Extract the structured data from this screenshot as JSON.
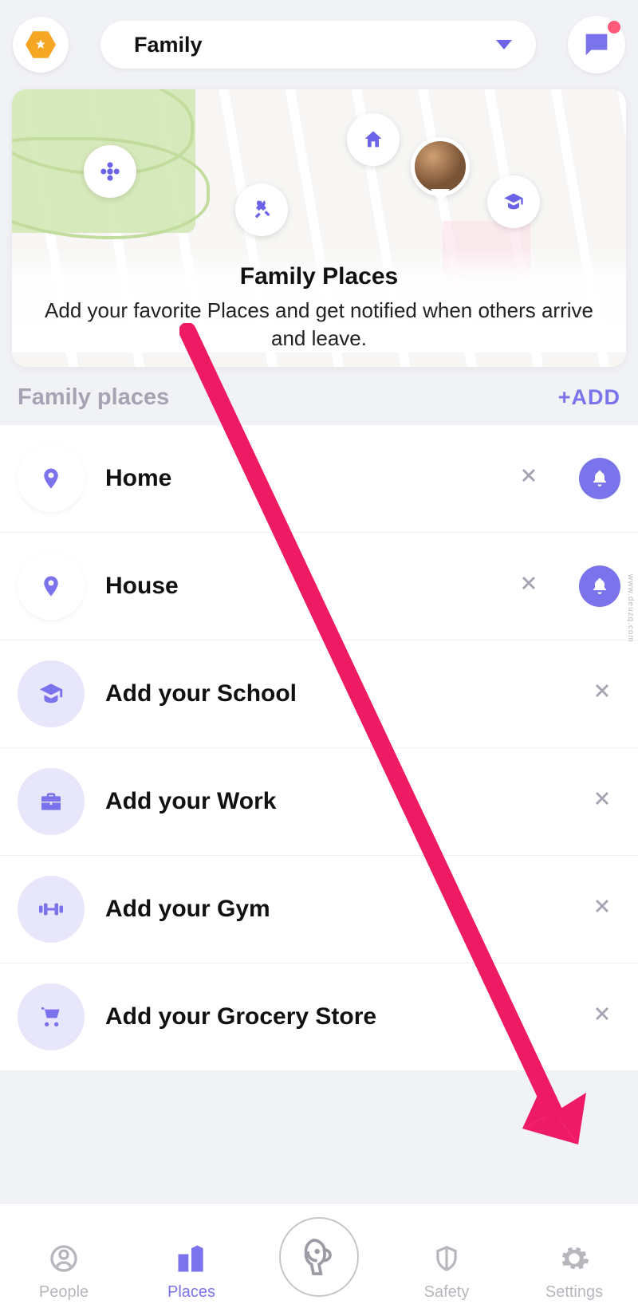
{
  "header": {
    "circle_name": "Family"
  },
  "hero": {
    "title": "Family Places",
    "subtitle": "Add your favorite Places and get notified when others arrive and leave."
  },
  "section": {
    "title": "Family places",
    "add_label": "+ADD"
  },
  "places": [
    {
      "label": "Home",
      "icon": "pin",
      "style": "solid",
      "has_bell": true
    },
    {
      "label": "House",
      "icon": "pin",
      "style": "solid",
      "has_bell": true
    },
    {
      "label": "Add your School",
      "icon": "school",
      "style": "soft",
      "has_bell": false
    },
    {
      "label": "Add your Work",
      "icon": "work",
      "style": "soft",
      "has_bell": false
    },
    {
      "label": "Add your Gym",
      "icon": "gym",
      "style": "soft",
      "has_bell": false
    },
    {
      "label": "Add your Grocery Store",
      "icon": "grocery",
      "style": "soft",
      "has_bell": false
    }
  ],
  "nav": {
    "people": "People",
    "places": "Places",
    "safety": "Safety",
    "settings": "Settings"
  },
  "colors": {
    "accent": "#7b73ec",
    "badge": "#f5a623",
    "annotation": "#ef1a64"
  }
}
